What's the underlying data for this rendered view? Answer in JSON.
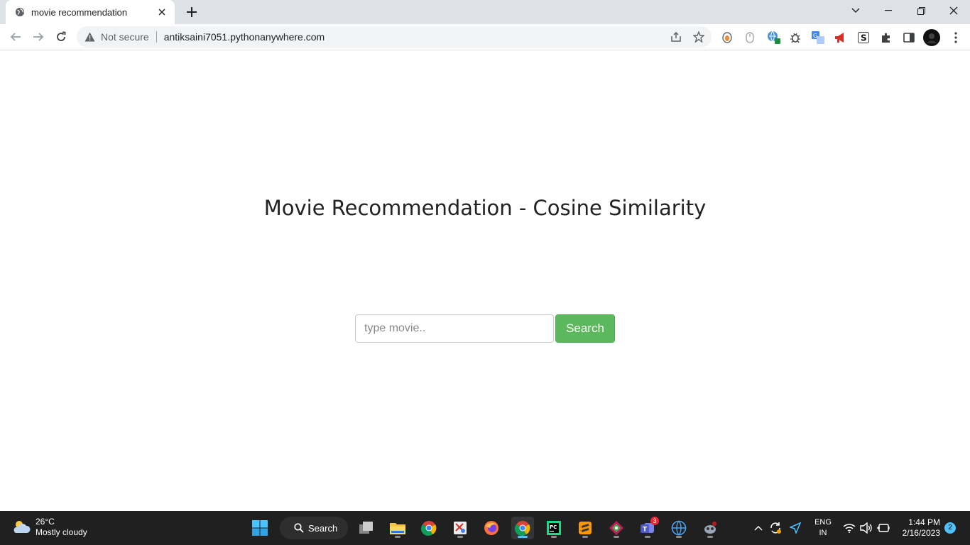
{
  "browser": {
    "tab_title": "movie recommendation",
    "secure_label": "Not secure",
    "url": "antiksaini7051.pythonanywhere.com"
  },
  "page": {
    "title": "Movie Recommendation - Cosine Similarity",
    "search_placeholder": "type movie..",
    "search_button": "Search"
  },
  "taskbar": {
    "weather_temp": "26°C",
    "weather_desc": "Mostly cloudy",
    "search_label": "Search",
    "teams_badge": "3",
    "lang_line1": "ENG",
    "lang_line2": "IN",
    "time": "1:44 PM",
    "date": "2/16/2023",
    "notification_count": "2"
  },
  "colors": {
    "accent_green": "#5cb85c",
    "taskbar_bg": "#202020",
    "tabstrip_bg": "#dee1e6"
  }
}
